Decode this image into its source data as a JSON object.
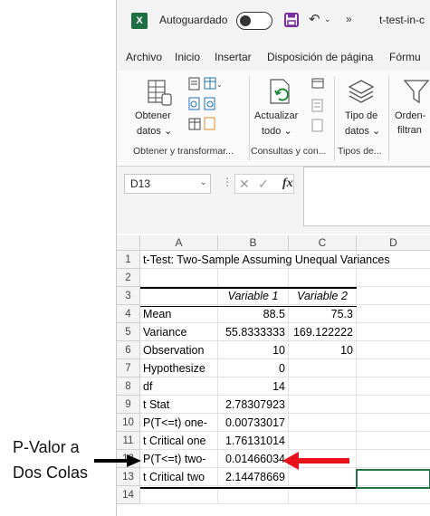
{
  "titlebar": {
    "app_logo": "X",
    "autosave_label": "Autoguardado",
    "more_label": "»",
    "doc_title": "t-test-in-c"
  },
  "menu": [
    "Archivo",
    "Inicio",
    "Insertar",
    "Disposición de página",
    "Fórmu"
  ],
  "ribbon": {
    "btn_obtener": [
      "Obtener",
      "datos ⌄"
    ],
    "btn_actualizar": [
      "Actualizar",
      "todo ⌄"
    ],
    "btn_tipo": [
      "Tipo de",
      "datos ⌄"
    ],
    "btn_orden": [
      "Orden-",
      "filtran"
    ],
    "group_labels": [
      "Obtener y transformar...",
      "Consultas y con...",
      "Tipos de..."
    ]
  },
  "formula_bar": {
    "name_box": "D13",
    "fx": "fx",
    "formula": ""
  },
  "sheet": {
    "columns": [
      "A",
      "B",
      "C",
      "D"
    ],
    "rows": [
      {
        "n": "1",
        "a": "t-Test: Two-Sample Assuming Unequal Variances",
        "b": "",
        "c": ""
      },
      {
        "n": "2",
        "a": "",
        "b": "",
        "c": ""
      },
      {
        "n": "3",
        "a": "",
        "b": "Variable 1",
        "c": "Variable 2"
      },
      {
        "n": "4",
        "a": "Mean",
        "b": "88.5",
        "c": "75.3"
      },
      {
        "n": "5",
        "a": "Variance",
        "b": "55.8333333",
        "c": "169.122222"
      },
      {
        "n": "6",
        "a": "Observation",
        "b": "10",
        "c": "10"
      },
      {
        "n": "7",
        "a": "Hypothesize",
        "b": "0",
        "c": ""
      },
      {
        "n": "8",
        "a": "df",
        "b": "14",
        "c": ""
      },
      {
        "n": "9",
        "a": "t Stat",
        "b": "2.78307923",
        "c": ""
      },
      {
        "n": "10",
        "a": "P(T<=t) one-",
        "b": "0.00733017",
        "c": ""
      },
      {
        "n": "11",
        "a": "t Critical one",
        "b": "1.76131014",
        "c": ""
      },
      {
        "n": "12",
        "a": "P(T<=t) two-",
        "b": "0.01466034",
        "c": ""
      },
      {
        "n": "13",
        "a": "t Critical two",
        "b": "2.14478669",
        "c": ""
      },
      {
        "n": "14",
        "a": "",
        "b": "",
        "c": ""
      }
    ]
  },
  "annotation": {
    "line1": "P-Valor a",
    "line2": "Dos Colas",
    "arrow_color": "#e8121b",
    "pointer_color": "#000000"
  },
  "colors": {
    "excel_green": "#1d6f42",
    "save_purple": "#7b2f9e",
    "selection_green": "#217346"
  }
}
